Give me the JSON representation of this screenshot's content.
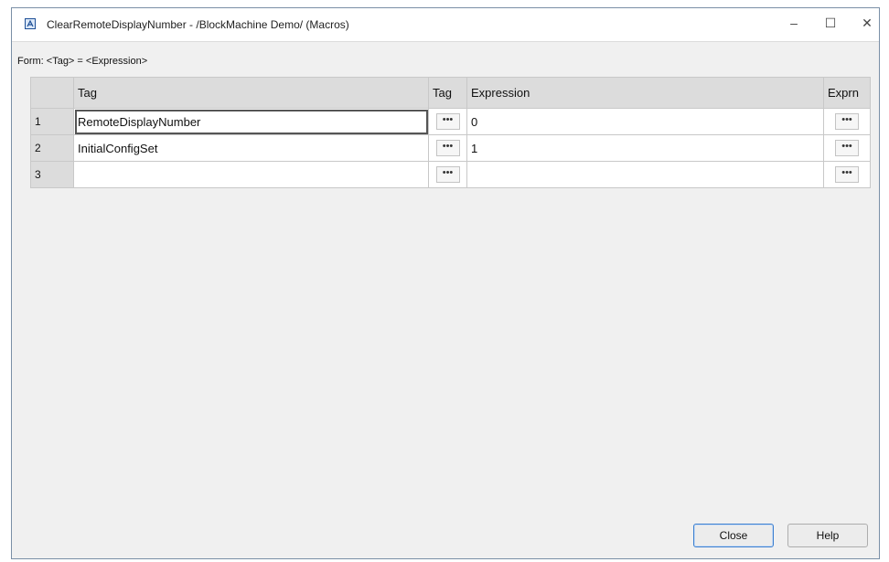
{
  "window": {
    "title": "ClearRemoteDisplayNumber - /BlockMachine Demo/ (Macros)",
    "controls": {
      "minimize": "–",
      "maximize": "☐",
      "close": "✕"
    }
  },
  "form_label": "Form: <Tag> = <Expression>",
  "grid": {
    "headers": {
      "num": "",
      "tag": "Tag",
      "tag_btn": "Tag",
      "expression": "Expression",
      "expr_btn": "Exprn"
    },
    "ellipsis": "•••",
    "rows": [
      {
        "num": "1",
        "tag": "RemoteDisplayNumber",
        "expression": "0"
      },
      {
        "num": "2",
        "tag": "InitialConfigSet",
        "expression": "1"
      },
      {
        "num": "3",
        "tag": "",
        "expression": ""
      }
    ]
  },
  "buttons": {
    "close": "Close",
    "help": "Help"
  }
}
